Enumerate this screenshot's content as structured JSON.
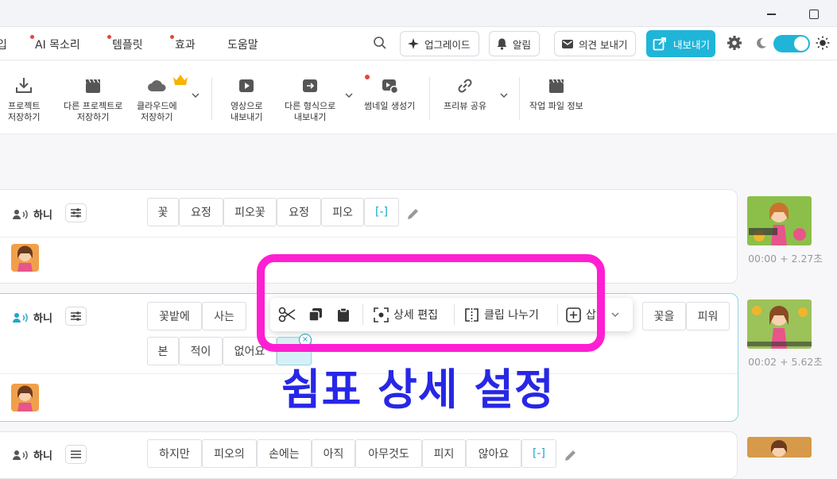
{
  "window": {
    "minimize": "minimize-button",
    "maximize": "maximize-button"
  },
  "menubar": {
    "partial": "입",
    "items": [
      {
        "label": "AI 목소리",
        "dot": true
      },
      {
        "label": "템플릿",
        "dot": true
      },
      {
        "label": "효과",
        "dot": true
      },
      {
        "label": "도움말",
        "dot": false
      }
    ],
    "upgrade": "업그레이드",
    "alerts": "알림",
    "feedback": "의견 보내기",
    "export": "내보내기"
  },
  "toolbar": {
    "tools": [
      {
        "label": "프로젝트\n저장하기"
      },
      {
        "label": "다른 프로젝트로\n저장하기"
      },
      {
        "label": "클라우드에\n저장하기"
      },
      {
        "label": "영상으로\n내보내기"
      },
      {
        "label": "다른 형식으로\n내보내기"
      },
      {
        "label": "썸네일 생성기"
      },
      {
        "label": "프리뷰 공유"
      },
      {
        "label": "작업 파일 정보"
      }
    ]
  },
  "clips": [
    {
      "speaker": "하니",
      "words": [
        "꽃",
        "요정",
        "피오꽃",
        "요정",
        "피오",
        "[-]"
      ],
      "thumb_time": "00:00 + 2.27초"
    },
    {
      "speaker": "하니",
      "words_row1": [
        "꽃밭에",
        "사는"
      ],
      "words_row1_right": [
        "꽃을",
        "피워"
      ],
      "words_row2": [
        "본",
        "적이",
        "없어요"
      ],
      "thumb_time": "00:02 + 5.62초"
    },
    {
      "speaker": "하니",
      "words": [
        "하지만",
        "피오의",
        "손에는",
        "아직",
        "아무것도",
        "피지",
        "않아요",
        "[-]"
      ]
    }
  ],
  "context_menu": {
    "detail_edit": "상세 편집",
    "split_clip": "클립 나누기",
    "insert": "삽입"
  },
  "annotation": "쉼표 상세 설정",
  "colors": {
    "accent": "#1fb5d8",
    "highlight": "#ff1fd2",
    "annotation": "#2727e6",
    "dot": "#e5463a"
  }
}
